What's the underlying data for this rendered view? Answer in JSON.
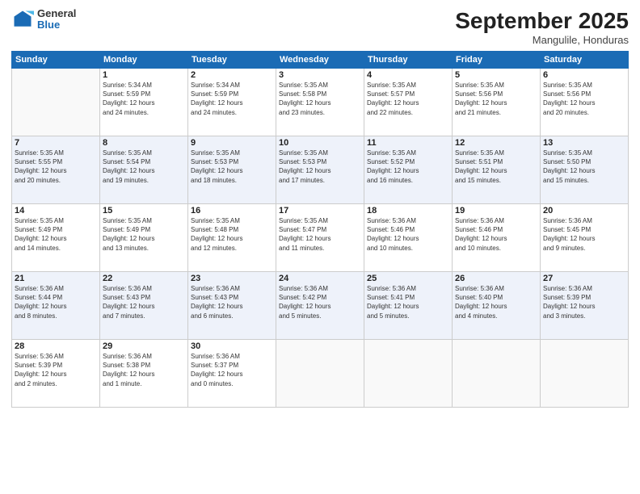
{
  "header": {
    "logo_general": "General",
    "logo_blue": "Blue",
    "month": "September 2025",
    "location": "Mangulile, Honduras"
  },
  "days_of_week": [
    "Sunday",
    "Monday",
    "Tuesday",
    "Wednesday",
    "Thursday",
    "Friday",
    "Saturday"
  ],
  "weeks": [
    [
      {
        "day": "",
        "info": ""
      },
      {
        "day": "1",
        "info": "Sunrise: 5:34 AM\nSunset: 5:59 PM\nDaylight: 12 hours\nand 24 minutes."
      },
      {
        "day": "2",
        "info": "Sunrise: 5:34 AM\nSunset: 5:59 PM\nDaylight: 12 hours\nand 24 minutes."
      },
      {
        "day": "3",
        "info": "Sunrise: 5:35 AM\nSunset: 5:58 PM\nDaylight: 12 hours\nand 23 minutes."
      },
      {
        "day": "4",
        "info": "Sunrise: 5:35 AM\nSunset: 5:57 PM\nDaylight: 12 hours\nand 22 minutes."
      },
      {
        "day": "5",
        "info": "Sunrise: 5:35 AM\nSunset: 5:56 PM\nDaylight: 12 hours\nand 21 minutes."
      },
      {
        "day": "6",
        "info": "Sunrise: 5:35 AM\nSunset: 5:56 PM\nDaylight: 12 hours\nand 20 minutes."
      }
    ],
    [
      {
        "day": "7",
        "info": "Sunrise: 5:35 AM\nSunset: 5:55 PM\nDaylight: 12 hours\nand 20 minutes."
      },
      {
        "day": "8",
        "info": "Sunrise: 5:35 AM\nSunset: 5:54 PM\nDaylight: 12 hours\nand 19 minutes."
      },
      {
        "day": "9",
        "info": "Sunrise: 5:35 AM\nSunset: 5:53 PM\nDaylight: 12 hours\nand 18 minutes."
      },
      {
        "day": "10",
        "info": "Sunrise: 5:35 AM\nSunset: 5:53 PM\nDaylight: 12 hours\nand 17 minutes."
      },
      {
        "day": "11",
        "info": "Sunrise: 5:35 AM\nSunset: 5:52 PM\nDaylight: 12 hours\nand 16 minutes."
      },
      {
        "day": "12",
        "info": "Sunrise: 5:35 AM\nSunset: 5:51 PM\nDaylight: 12 hours\nand 15 minutes."
      },
      {
        "day": "13",
        "info": "Sunrise: 5:35 AM\nSunset: 5:50 PM\nDaylight: 12 hours\nand 15 minutes."
      }
    ],
    [
      {
        "day": "14",
        "info": "Sunrise: 5:35 AM\nSunset: 5:49 PM\nDaylight: 12 hours\nand 14 minutes."
      },
      {
        "day": "15",
        "info": "Sunrise: 5:35 AM\nSunset: 5:49 PM\nDaylight: 12 hours\nand 13 minutes."
      },
      {
        "day": "16",
        "info": "Sunrise: 5:35 AM\nSunset: 5:48 PM\nDaylight: 12 hours\nand 12 minutes."
      },
      {
        "day": "17",
        "info": "Sunrise: 5:35 AM\nSunset: 5:47 PM\nDaylight: 12 hours\nand 11 minutes."
      },
      {
        "day": "18",
        "info": "Sunrise: 5:36 AM\nSunset: 5:46 PM\nDaylight: 12 hours\nand 10 minutes."
      },
      {
        "day": "19",
        "info": "Sunrise: 5:36 AM\nSunset: 5:46 PM\nDaylight: 12 hours\nand 10 minutes."
      },
      {
        "day": "20",
        "info": "Sunrise: 5:36 AM\nSunset: 5:45 PM\nDaylight: 12 hours\nand 9 minutes."
      }
    ],
    [
      {
        "day": "21",
        "info": "Sunrise: 5:36 AM\nSunset: 5:44 PM\nDaylight: 12 hours\nand 8 minutes."
      },
      {
        "day": "22",
        "info": "Sunrise: 5:36 AM\nSunset: 5:43 PM\nDaylight: 12 hours\nand 7 minutes."
      },
      {
        "day": "23",
        "info": "Sunrise: 5:36 AM\nSunset: 5:43 PM\nDaylight: 12 hours\nand 6 minutes."
      },
      {
        "day": "24",
        "info": "Sunrise: 5:36 AM\nSunset: 5:42 PM\nDaylight: 12 hours\nand 5 minutes."
      },
      {
        "day": "25",
        "info": "Sunrise: 5:36 AM\nSunset: 5:41 PM\nDaylight: 12 hours\nand 5 minutes."
      },
      {
        "day": "26",
        "info": "Sunrise: 5:36 AM\nSunset: 5:40 PM\nDaylight: 12 hours\nand 4 minutes."
      },
      {
        "day": "27",
        "info": "Sunrise: 5:36 AM\nSunset: 5:39 PM\nDaylight: 12 hours\nand 3 minutes."
      }
    ],
    [
      {
        "day": "28",
        "info": "Sunrise: 5:36 AM\nSunset: 5:39 PM\nDaylight: 12 hours\nand 2 minutes."
      },
      {
        "day": "29",
        "info": "Sunrise: 5:36 AM\nSunset: 5:38 PM\nDaylight: 12 hours\nand 1 minute."
      },
      {
        "day": "30",
        "info": "Sunrise: 5:36 AM\nSunset: 5:37 PM\nDaylight: 12 hours\nand 0 minutes."
      },
      {
        "day": "",
        "info": ""
      },
      {
        "day": "",
        "info": ""
      },
      {
        "day": "",
        "info": ""
      },
      {
        "day": "",
        "info": ""
      }
    ]
  ]
}
